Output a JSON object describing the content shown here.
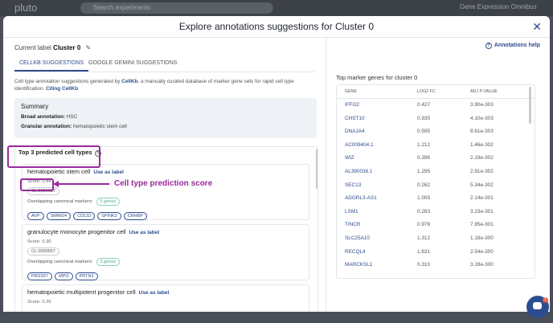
{
  "topbar": {
    "logo": "pluto",
    "search_placeholder": "Search experiments",
    "user": "Gene Expression Omnibus"
  },
  "modal": {
    "title": "Explore annotations suggestions for Cluster 0",
    "close_icon": "close-icon"
  },
  "current_label": {
    "prefix": "Current label",
    "value": "Cluster 0",
    "edit_icon": "pencil-icon"
  },
  "tabs": [
    {
      "label": "CELLKB SUGGESTIONS",
      "active": true
    },
    {
      "label": "GOOGLE GEMINI SUGGESTIONS",
      "active": false
    }
  ],
  "description": {
    "part1": "Cell type annotation suggestions generated by ",
    "link1": "CellKb",
    "part2": ", a manually curated database of marker gene sets for rapid cell type identification. ",
    "link2": "Citing CellKb"
  },
  "summary": {
    "heading": "Summary",
    "broad_label": "Broad annotation:",
    "broad_value": "HSC",
    "granular_label": "Granular annotation:",
    "granular_value": "hematopoietic stem cell"
  },
  "predictions": {
    "heading": "Top 3 predicted cell types",
    "use_label": "Use as label",
    "overlap_label": "Overlapping canonical markers:",
    "items": [
      {
        "name": "hematopoietic stem cell",
        "score": "Score: 0.44",
        "cl": "CL:0000037",
        "gene_count": "5 genes",
        "genes": [
          "AVP",
          "SMIM24",
          "CD133",
          "SPINK2",
          "CRHBP"
        ]
      },
      {
        "name": "granulocyte monocyte progenitor cell",
        "score": "Score: 0.30",
        "cl": "CL:0000557",
        "gene_count": "3 genes",
        "genes": [
          "PRSS57",
          "MPO",
          "PRTN3"
        ]
      },
      {
        "name": "hematopoietic multipotent progenitor cell",
        "score": "Score: 0.26"
      }
    ]
  },
  "annotation": {
    "text": "Cell type prediction score",
    "color": "#9a2a9a"
  },
  "annotations_help": "Annotations help",
  "markers": {
    "title": "Top marker genes for cluster 0",
    "headers": {
      "gene": "GENE",
      "log2fc": "LOG2 FC",
      "pval": "ADJ P-VALUE"
    },
    "rows": [
      {
        "gene": "IFFO2",
        "log2fc": "0.427",
        "pval": "3.90e-303"
      },
      {
        "gene": "CHST10",
        "log2fc": "0.935",
        "pval": "4.10e-303"
      },
      {
        "gene": "DNAJA4",
        "log2fc": "0.595",
        "pval": "8.61e-303"
      },
      {
        "gene": "AC009404.1",
        "log2fc": "1.212",
        "pval": "1.46e-302"
      },
      {
        "gene": "WIZ",
        "log2fc": "0.396",
        "pval": "2.19e-302"
      },
      {
        "gene": "AL390036.1",
        "log2fc": "1.295",
        "pval": "2.91e-302"
      },
      {
        "gene": "SEC13",
        "log2fc": "0.262",
        "pval": "5.34e-302"
      },
      {
        "gene": "ADGRL3-AS1",
        "log2fc": "1.005",
        "pval": "2.14e-301"
      },
      {
        "gene": "LSM1",
        "log2fc": "0.283",
        "pval": "3.23e-301"
      },
      {
        "gene": "TINCR",
        "log2fc": "0.976",
        "pval": "7.95e-301"
      },
      {
        "gene": "SLC25A10",
        "log2fc": "1.312",
        "pval": "1.18e-300"
      },
      {
        "gene": "RECQL4",
        "log2fc": "1.631",
        "pval": "2.54e-300"
      },
      {
        "gene": "MARCKSL1",
        "log2fc": "0.310",
        "pval": "3.28e-300"
      }
    ]
  },
  "chat": {
    "icon": "chat-icon",
    "count": "1"
  },
  "colors": {
    "accent": "#2c4d8f",
    "highlight": "#9a2a9a",
    "badge": "#4ea888"
  }
}
